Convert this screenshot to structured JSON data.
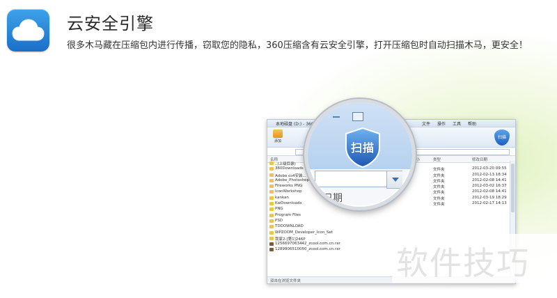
{
  "header": {
    "title": "云安全引擎",
    "description": "很多木马藏在压缩包内进行传播，窃取您的隐私，360压缩含有云安全引擎，打开压缩包时自动扫描木马，更安全！"
  },
  "app_window": {
    "title": "本地磁盘 (D:) - 360",
    "menu": [
      "文件",
      "操作",
      "工具",
      "帮助"
    ],
    "toolbar": {
      "add_label": "添加",
      "scan_label": "扫描"
    },
    "columns": {
      "name": "名称",
      "size": "大小",
      "type": "类型",
      "modified": "修改日期"
    },
    "rows": [
      {
        "name": "..(上级目录)",
        "type": "",
        "date": "",
        "kind": "up"
      },
      {
        "name": "360Downloads",
        "type": "文件夹",
        "date": "2012-03-20 09:55",
        "kind": "folder"
      },
      {
        "name": "Adobe cs4安装...",
        "type": "文件夹",
        "date": "2012-02-13 18:34",
        "kind": "folder"
      },
      {
        "name": "Adobe_Photoshop...",
        "type": "文件夹",
        "date": "2012-02-08 14:41",
        "kind": "folder"
      },
      {
        "name": "Fireworks PNG",
        "type": "文件夹",
        "date": "2012-03-02 16:37",
        "kind": "folder"
      },
      {
        "name": "IconWorkshop",
        "type": "文件夹",
        "date": "2012-02-08 14:41",
        "kind": "folder"
      },
      {
        "name": "kankan",
        "type": "文件夹",
        "date": "2012-03-19 18:29",
        "kind": "folder"
      },
      {
        "name": "KwDownloadx",
        "type": "文件夹",
        "date": "2012-02-17 14:13",
        "kind": "folder"
      },
      {
        "name": "PNG",
        "type": "",
        "date": "",
        "kind": "folder"
      },
      {
        "name": "Program Files",
        "type": "",
        "date": "",
        "kind": "folder"
      },
      {
        "name": "PSD",
        "type": "",
        "date": "",
        "kind": "folder"
      },
      {
        "name": "TDDOWNLOAD",
        "type": "",
        "date": "",
        "kind": "folder"
      },
      {
        "name": "WPZOOM_Developer_Icon_Set",
        "type": "",
        "date": "",
        "kind": "folder"
      },
      {
        "name": "我家2-[第1]246P",
        "type": "",
        "date": "",
        "kind": "folder"
      },
      {
        "name": "1256697063442_zcool.com.cn.rar",
        "type": "",
        "date": "",
        "kind": "archive"
      },
      {
        "name": "1289906510050_zcool.com.cn.rar",
        "type": "",
        "date": "",
        "kind": "archive"
      }
    ],
    "status_text": "双击在浏览文件夹"
  },
  "magnifier": {
    "shield_label": "扫描",
    "partial_label": "日期"
  },
  "watermark": "软件技巧",
  "colors": {
    "icon_blue": "#1a6fc8",
    "shield_blue": "#1d5fbf",
    "folder_yellow": "#f0c350"
  }
}
